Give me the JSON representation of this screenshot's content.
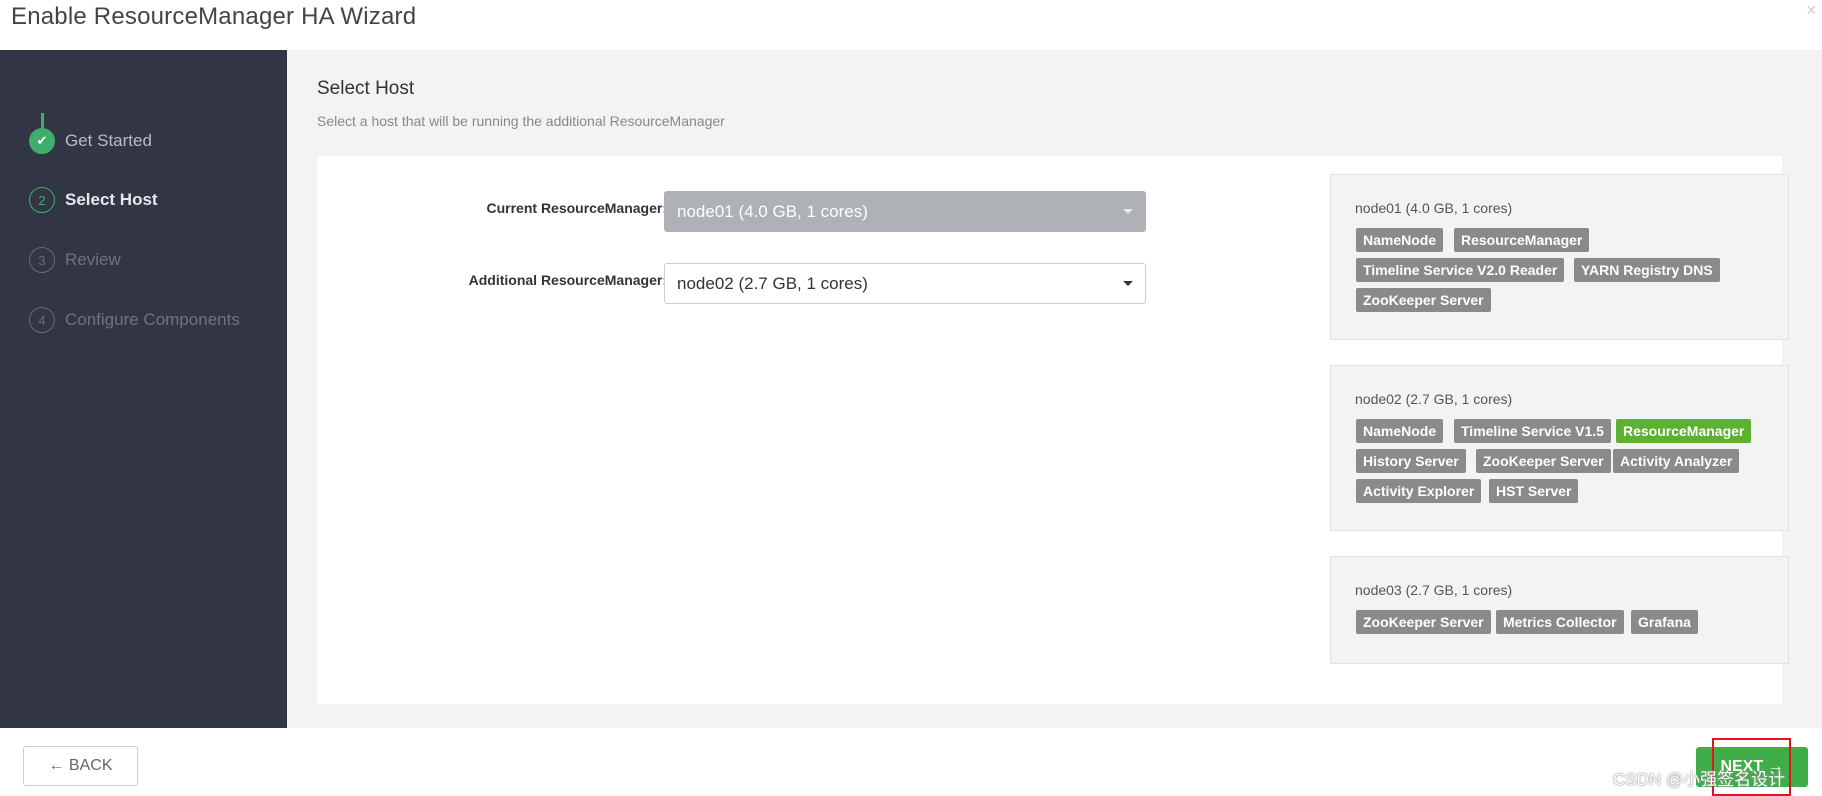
{
  "header": {
    "title": "Enable ResourceManager HA Wizard",
    "close_glyph": "×"
  },
  "sidebar": {
    "steps": [
      {
        "number": "✔",
        "label": "Get Started",
        "state": "done"
      },
      {
        "number": "2",
        "label": "Select Host",
        "state": "active"
      },
      {
        "number": "3",
        "label": "Review",
        "state": "pending"
      },
      {
        "number": "4",
        "label": "Configure Components",
        "state": "pending"
      }
    ]
  },
  "main": {
    "title": "Select Host",
    "subtitle": "Select a host that will be running the additional ResourceManager",
    "current_rm": {
      "label": "Current ResourceManager:",
      "value": "node01 (4.0 GB, 1 cores)"
    },
    "additional_rm": {
      "label": "Additional ResourceManager:",
      "value": "node02 (2.7 GB, 1 cores)"
    },
    "hosts": [
      {
        "name": "node01 (4.0 GB, 1 cores)",
        "components": [
          "NameNode",
          "ResourceManager",
          "Timeline Service V2.0 Reader",
          "YARN Registry DNS",
          "ZooKeeper Server"
        ]
      },
      {
        "name": "node02 (2.7 GB, 1 cores)",
        "components": [
          "NameNode",
          "Timeline Service V1.5",
          "ResourceManager",
          "History Server",
          "ZooKeeper Server",
          "Activity Analyzer",
          "Activity Explorer",
          "HST Server"
        ]
      },
      {
        "name": "node03 (2.7 GB, 1 cores)",
        "components": [
          "ZooKeeper Server",
          "Metrics Collector",
          "Grafana"
        ]
      }
    ]
  },
  "footer": {
    "back_label": "← BACK",
    "next_label": "NEXT →",
    "watermark": "CSDN @小强签名设计"
  },
  "colors": {
    "accent_green": "#3fae6c",
    "badge_green": "#5cb131",
    "badge_gray": "#8a8a8a",
    "sidebar_bg": "#323544",
    "highlight_red": "#e0141e"
  }
}
